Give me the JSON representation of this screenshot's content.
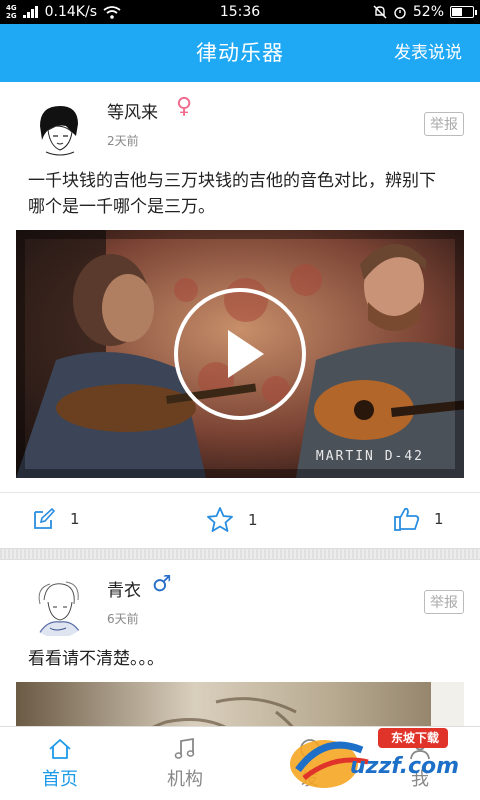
{
  "status_bar": {
    "network": "4G",
    "network_alt": "2G",
    "speed": "0.14K/s",
    "time": "15:36",
    "battery": "52%",
    "battery_level": 0.52
  },
  "app_bar": {
    "title": "律动乐器",
    "post_button": "发表说说"
  },
  "posts": [
    {
      "username": "等风来",
      "gender": "female",
      "gender_symbol": "♀",
      "time": "2天前",
      "report": "举报",
      "text": "一千块钱的吉他与三万块钱的吉他的音色对比，辨别下哪个是一千哪个是三万。",
      "video_caption": "Martin D-42",
      "comments": "1",
      "favorites": "1",
      "likes": "1"
    },
    {
      "username": "青衣",
      "gender": "male",
      "gender_symbol": "♂",
      "time": "6天前",
      "report": "举报",
      "text": "看看请不清楚。。。"
    }
  ],
  "bottom_nav": [
    {
      "label": "首页",
      "icon": "home-icon",
      "active": true
    },
    {
      "label": "机构",
      "icon": "music-note-icon",
      "active": false
    },
    {
      "label": "发",
      "icon": "post-icon",
      "active": false
    },
    {
      "label": "我",
      "icon": "profile-icon",
      "active": false
    }
  ],
  "watermark": {
    "brand": "uzzf.com",
    "tag": "东坡下载"
  },
  "colors": {
    "accent": "#1fa9f4",
    "nav_active": "#1c9ae8",
    "female": "#f06b8e",
    "male": "#2a6fc9"
  }
}
